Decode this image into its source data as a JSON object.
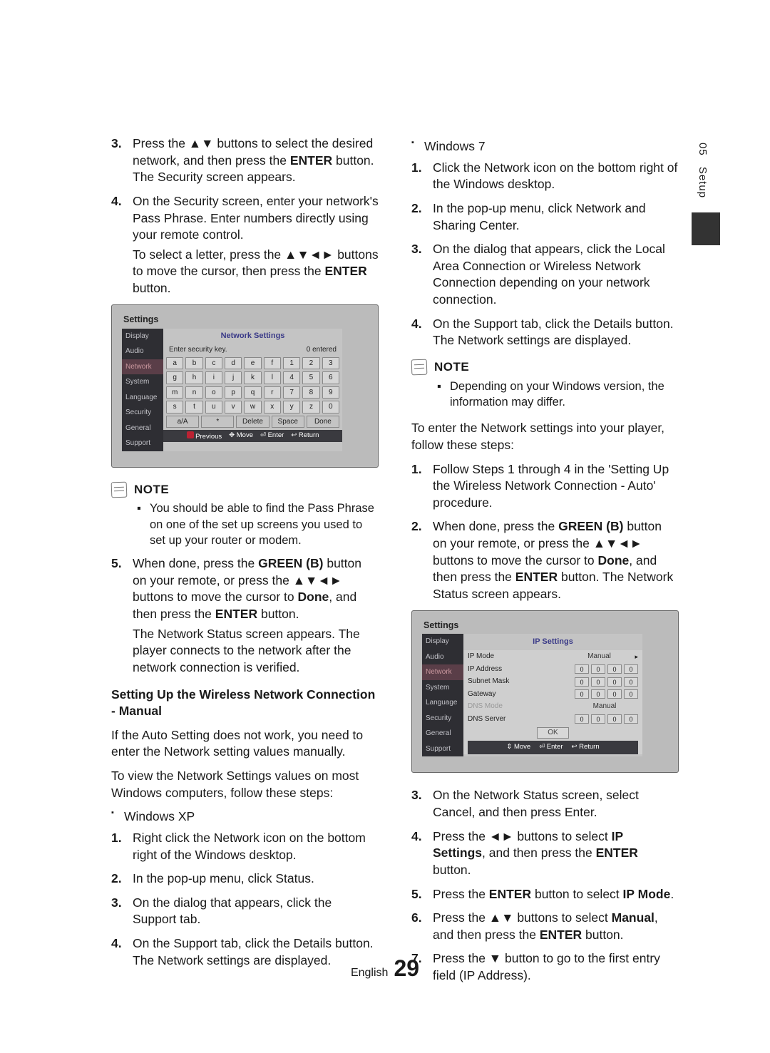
{
  "side": {
    "chapter": "05",
    "title": "Setup"
  },
  "left": {
    "steps_a": [
      {
        "n": "3.",
        "t": [
          "Press the ",
          "▲▼",
          " buttons to select the desired network, and then press the ",
          "ENTER",
          " button. The Security screen appears."
        ]
      },
      {
        "n": "4.",
        "t": [
          "On the Security screen, enter your network's Pass Phrase. Enter numbers directly using your remote control."
        ],
        "sub": [
          "To select a letter, press the ",
          "▲▼◄►",
          " buttons to move the cursor, then press the ",
          "ENTER",
          " button."
        ]
      }
    ],
    "tv": {
      "title": "Settings",
      "menu": [
        "Display",
        "Audio",
        "Network",
        "System",
        "Language",
        "Security",
        "General",
        "Support"
      ],
      "panel_title": "Network Settings",
      "enter_label": "Enter security key.",
      "entered": "0 entered",
      "rows": [
        [
          "a",
          "b",
          "c",
          "d",
          "e",
          "f",
          "1",
          "2",
          "3"
        ],
        [
          "g",
          "h",
          "i",
          "j",
          "k",
          "l",
          "4",
          "5",
          "6"
        ],
        [
          "m",
          "n",
          "o",
          "p",
          "q",
          "r",
          "7",
          "8",
          "9"
        ],
        [
          "s",
          "t",
          "u",
          "v",
          "w",
          "x",
          "y",
          "z",
          "0"
        ]
      ],
      "actions": [
        "a/A",
        "*",
        "Delete",
        "Space",
        "Done"
      ],
      "legend": [
        "Previous",
        "Move",
        "Enter",
        "Return"
      ]
    },
    "note_label": "NOTE",
    "note_body": "You should be able to find the Pass Phrase on one of the set up screens you used to set up your router or modem.",
    "steps_b": [
      {
        "n": "5.",
        "t": [
          "When done, press the ",
          "GREEN (B)",
          " button on your remote, or press the ",
          "▲▼◄►",
          " buttons to move the cursor to ",
          "Done",
          ", and then press the ",
          "ENTER",
          " button."
        ],
        "sub2": "The Network Status screen appears. The player connects to the network after the network connection is verified."
      }
    ],
    "h_manual": "Setting Up the Wireless Network Connection - Manual",
    "manual_p1": "If the Auto Setting does not work, you need to enter the Network setting values manually.",
    "manual_p2": "To view the Network Settings values on most Windows computers, follow these steps:",
    "xp_label": "Windows XP",
    "xp_steps": [
      {
        "n": "1.",
        "t": "Right click the Network icon on the bottom right of the Windows desktop."
      },
      {
        "n": "2.",
        "t": "In the pop-up menu, click Status."
      },
      {
        "n": "3.",
        "t": "On the dialog that appears, click the Support tab."
      },
      {
        "n": "4.",
        "t": "On the Support tab, click the Details button. The Network settings are displayed."
      }
    ]
  },
  "right": {
    "w7_label": "Windows 7",
    "w7_steps": [
      {
        "n": "1.",
        "t": "Click the Network icon on the bottom right of the Windows desktop."
      },
      {
        "n": "2.",
        "t": "In the pop-up menu, click Network and Sharing Center."
      },
      {
        "n": "3.",
        "t": "On the dialog that appears, click the Local Area Connection or Wireless Network Connection depending on your network connection."
      },
      {
        "n": "4.",
        "t": "On the Support tab, click the Details button. The Network settings are displayed."
      }
    ],
    "note_label": "NOTE",
    "note_body": "Depending on your Windows version, the information may differ.",
    "enter_p": "To enter the Network settings into your player, follow these steps:",
    "steps_c": [
      {
        "n": "1.",
        "t": "Follow Steps 1 through 4 in the 'Setting Up the Wireless Network Connection - Auto' procedure."
      },
      {
        "n": "2.",
        "t": [
          "When done, press the ",
          "GREEN (B)",
          " button on your remote, or press the ",
          "▲▼◄►",
          " buttons to move the cursor to ",
          "Done",
          ", and then press the ",
          "ENTER",
          " button. The Network Status screen appears."
        ]
      }
    ],
    "ip": {
      "title": "Settings",
      "menu": [
        "Display",
        "Audio",
        "Network",
        "System",
        "Language",
        "Security",
        "General",
        "Support"
      ],
      "panel_title": "IP Settings",
      "rows": [
        {
          "label": "IP Mode",
          "value_text": "Manual",
          "arrow": true
        },
        {
          "label": "IP Address",
          "boxes": [
            "0",
            "0",
            "0",
            "0"
          ]
        },
        {
          "label": "Subnet Mask",
          "boxes": [
            "0",
            "0",
            "0",
            "0"
          ]
        },
        {
          "label": "Gateway",
          "boxes": [
            "0",
            "0",
            "0",
            "0"
          ]
        },
        {
          "label": "DNS Mode",
          "value_text": "Manual",
          "muted": true
        },
        {
          "label": "DNS Server",
          "boxes": [
            "0",
            "0",
            "0",
            "0"
          ]
        }
      ],
      "ok": "OK",
      "legend": [
        "Move",
        "Enter",
        "Return"
      ]
    },
    "steps_d": [
      {
        "n": "3.",
        "t": "On the Network Status screen, select Cancel, and then press Enter."
      },
      {
        "n": "4.",
        "t": [
          "Press the ",
          "◄►",
          " buttons to select ",
          "IP Settings",
          ", and then press the ",
          "ENTER",
          " button."
        ]
      },
      {
        "n": "5.",
        "t": [
          "Press the ",
          "ENTER",
          " button to select ",
          "IP Mode",
          "."
        ]
      },
      {
        "n": "6.",
        "t": [
          "Press the ",
          "▲▼",
          " buttons to select ",
          "Manual",
          ", and then press the ",
          "ENTER",
          " button."
        ]
      },
      {
        "n": "7.",
        "t": [
          "Press the ",
          "▼",
          " button to go to the first entry field (IP Address)."
        ]
      }
    ]
  },
  "footer": {
    "lang": "English",
    "page": "29"
  }
}
